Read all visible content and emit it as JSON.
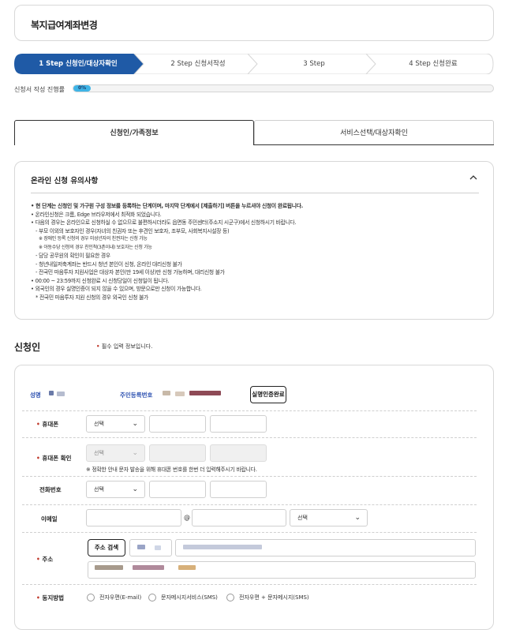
{
  "page": {
    "title": "복지급여계좌변경"
  },
  "steps": [
    {
      "label": "1 Step 신청인/대상자확인",
      "active": true
    },
    {
      "label": "2 Step 신청서작성",
      "active": false
    },
    {
      "label": "3 Step",
      "active": false
    },
    {
      "label": "4 Step 신청완료",
      "active": false
    }
  ],
  "progress": {
    "label": "신청서 작성 진행률",
    "value_text": "0%",
    "value": 0
  },
  "tabs": [
    {
      "label": "신청인/가족정보",
      "active": true
    },
    {
      "label": "서비스선택/대상자확인",
      "active": false
    }
  ],
  "notice": {
    "title": "온라인 신청 유의사항",
    "lines": [
      "• 현 단계는 신청인 및 가구원 구성 정보를 등록하는 단계이며, 마지막 단계에서 [제출하기] 버튼을 누르셔야 신청이 완료됩니다.",
      "• 온라인신청은 크롬, Edge 브라우저에서 최적화 되었습니다.",
      "• 다음의 경우는 온라인으로 신청하실 수 없으므로 불편하시더라도 읍면동 주민센터(주소지 시군구)에서 신청하시기 바랍니다.",
      "- 부모 이외의 보호자인 경우(자녀의 친권자 또는 후견인 보호자, 조부모, 사회복지시설장 등)",
      "※ 장애인 등록 신청의 경우 미성년자의 친권자는 신청 가능",
      "※ 아동수당 신청의 경우 친인척(3촌이내) 보호자는 신청 가능",
      "- 담당 공무원의 확인이 필요한 경우",
      "- 청년내일저축계좌는 반드시 청년 본인이 신청, 온라인 대리신청 불가",
      "- 전국민 마음투자 지원사업은 대상자 본인(만 19세 이상)만 신청 가능하며, 대리신청 불가",
      "• 00:00 ~ 23:59까지 신청완료 시 신청당일이 신청일이 됩니다.",
      "• 외국인의 경우 실명인증이 되지 않을 수 있으며, 방문으로만 신청이 가능합니다.",
      "* 전국민 마음투자 지원 신청의 경우 외국인 신청 불가"
    ]
  },
  "applicant": {
    "section_title": "신청인",
    "required_note": "필수 입력 정보입니다.",
    "name_label": "성명",
    "rrn_label": "주민등록번호",
    "auth_button": "실명인증완료",
    "mobile_label": "휴대폰",
    "mobile_select": "선택",
    "mobile_confirm_label": "휴대폰 확인",
    "mobile_confirm_select": "선택",
    "mobile_confirm_note": "※ 정확한 안내 문자 발송을 위해 휴대폰 번호를 한번 더 입력해주시기 바랍니다.",
    "phone_label": "전화번호",
    "phone_select": "선택",
    "email_label": "이메일",
    "email_at": "@",
    "email_select": "선택",
    "address_label": "주소",
    "address_button": "주소 검색",
    "consent_label": "동지방법",
    "consent_options": [
      "전자우편(E-mail)",
      "문자메시지서비스(SMS)",
      "전자우편 + 문자메시지(SMS)"
    ]
  },
  "colors": {
    "step_active": "#1f5aa6",
    "progress": "#3fb4e6",
    "required": "#c0392b",
    "name_label": "#2b4fb0"
  }
}
